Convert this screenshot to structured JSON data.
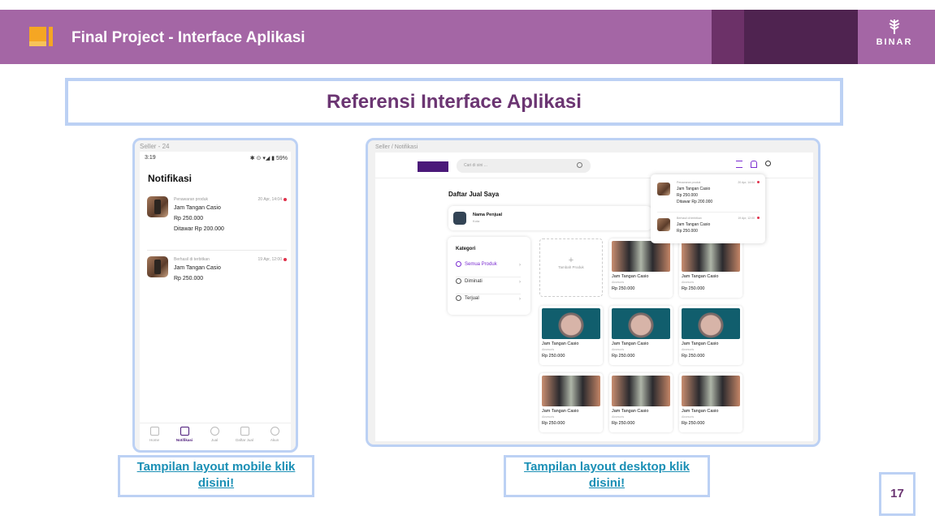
{
  "header": {
    "title": "Final Project - Interface Aplikasi",
    "brand": "BINAR",
    "colors": {
      "bar": "#a466a5",
      "dark": "#4f2350",
      "accent": "#f5a623"
    }
  },
  "reference": {
    "title": "Referensi Interface Aplikasi"
  },
  "mobile": {
    "frame_label": "Seller - 24",
    "time": "3:19",
    "status_icons": "✱ ⊙ ▾◢ ▮ 59%",
    "title": "Notifikasi",
    "notifications": [
      {
        "category": "Penawaran produk",
        "date": "20 Apr, 14:04",
        "product": "Jam Tangan Casio",
        "price": "Rp 250.000",
        "offer": "Ditawar Rp 200.000"
      },
      {
        "category": "Berhasil di terbitkan",
        "date": "19 Apr, 12:00",
        "product": "Jam Tangan Casio",
        "price": "Rp 250.000",
        "offer": ""
      }
    ],
    "nav": [
      "Home",
      "Notifikasi",
      "Jual",
      "Daftar Jual",
      "Akun"
    ]
  },
  "desktop": {
    "frame_label": "Seller / Notifikasi",
    "search_placeholder": "Cari di sini ...",
    "heading": "Daftar Jual Saya",
    "seller_name": "Nama Penjual",
    "seller_city": "Kota",
    "kategori_title": "Kategori",
    "kategori": [
      "Semua Produk",
      "Diminati",
      "Terjual"
    ],
    "add_label": "Tambah Produk",
    "popup": [
      {
        "category": "Penawaran produk",
        "date": "20 Apr, 14:04",
        "product": "Jam Tangan Casio",
        "price": "Rp 250.000",
        "offer": "Ditawar Rp 200.000"
      },
      {
        "category": "Berhasil di terbitkan",
        "date": "19 Apr, 12:00",
        "product": "Jam Tangan Casio",
        "price": "Rp 250.000",
        "offer": ""
      }
    ],
    "products": [
      {
        "name": "Jam Tangan Casio",
        "category": "Aksesoris",
        "price": "Rp 250.000"
      },
      {
        "name": "Jam Tangan Casio",
        "category": "Aksesoris",
        "price": "Rp 250.000"
      },
      {
        "name": "Jam Tangan Casio",
        "category": "Aksesoris",
        "price": "Rp 250.000"
      },
      {
        "name": "Jam Tangan Casio",
        "category": "Aksesoris",
        "price": "Rp 250.000"
      },
      {
        "name": "Jam Tangan Casio",
        "category": "Aksesoris",
        "price": "Rp 250.000"
      },
      {
        "name": "Jam Tangan Casio",
        "category": "Aksesoris",
        "price": "Rp 250.000"
      },
      {
        "name": "Jam Tangan Casio",
        "category": "Aksesoris",
        "price": "Rp 250.000"
      },
      {
        "name": "Jam Tangan Casio",
        "category": "Aksesoris",
        "price": "Rp 250.000"
      }
    ]
  },
  "links": {
    "mobile": "Tampilan layout mobile klik disini!",
    "desktop": "Tampilan layout desktop klik disini!"
  },
  "page_number": "17"
}
